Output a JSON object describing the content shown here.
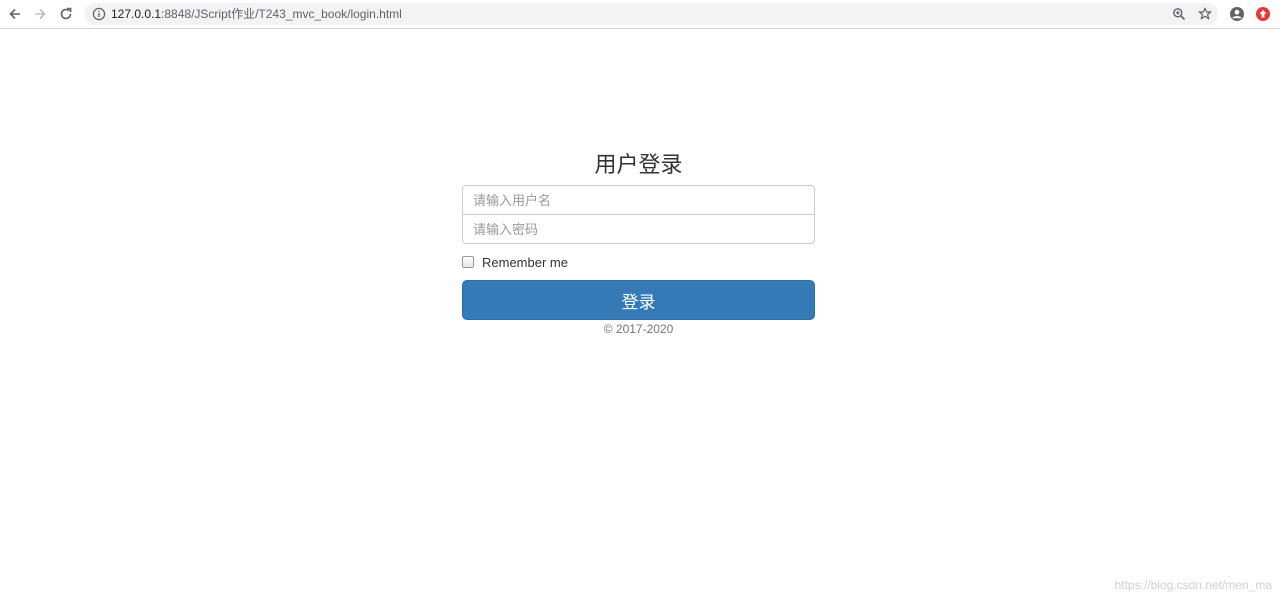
{
  "browser": {
    "url_host": "127.0.0.1",
    "url_rest": ":8848/JScript作业/T243_mvc_book/login.html",
    "icons": {
      "back": "back-arrow-icon",
      "forward": "forward-arrow-icon",
      "reload": "reload-icon",
      "site_info": "info-icon",
      "zoom": "zoom-icon",
      "bookmark": "star-icon",
      "account": "account-icon",
      "extension": "extension-icon"
    },
    "colors": {
      "omnibox_bg": "#f1f3f4",
      "extension_red": "#e53935"
    }
  },
  "login": {
    "title": "用户登录",
    "username_placeholder": "请输入用户名",
    "password_placeholder": "请输入密码",
    "username_value": "",
    "password_value": "",
    "remember_label": "Remember me",
    "remember_checked": false,
    "submit_label": "登录",
    "copyright": "© 2017-2020",
    "colors": {
      "primary": "#337ab7",
      "primary_border": "#2e6da4"
    }
  },
  "watermark": "https://blog.csdn.net/men_ma"
}
